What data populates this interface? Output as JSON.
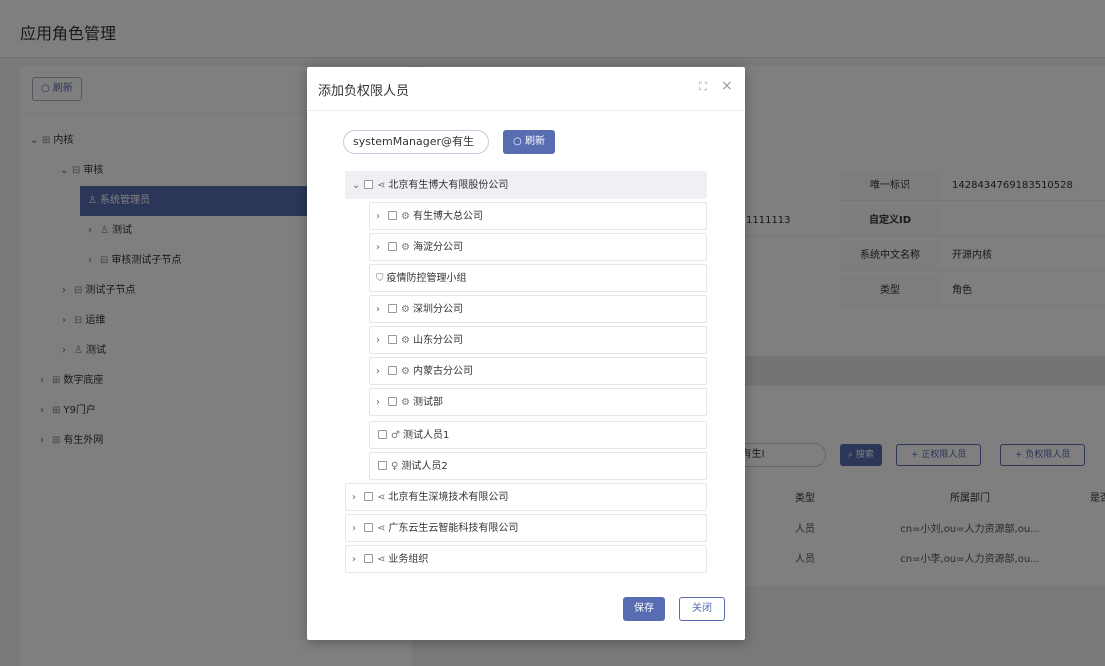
{
  "page": {
    "title": "应用角色管理"
  },
  "left": {
    "refresh_label": "刷新",
    "tree": [
      {
        "label": "内核",
        "icon": "grid-icon",
        "arrow": "v"
      },
      {
        "label": "审核",
        "icon": "folder-icon",
        "arrow": "v"
      },
      {
        "label": "系统管理员",
        "icon": "role-icon",
        "arrow": ""
      },
      {
        "label": "测试",
        "icon": "role-icon",
        "arrow": ">"
      },
      {
        "label": "审核测试子节点",
        "icon": "folder-icon",
        "arrow": ">"
      },
      {
        "label": "测试子节点",
        "icon": "folder-icon",
        "arrow": ">"
      },
      {
        "label": "运维",
        "icon": "folder-icon",
        "arrow": ">"
      },
      {
        "label": "测试",
        "icon": "role-icon",
        "arrow": ">"
      },
      {
        "label": "数字底座",
        "icon": "grid-icon",
        "arrow": ">"
      },
      {
        "label": "Y9门户",
        "icon": "grid-icon",
        "arrow": ">"
      },
      {
        "label": "有生外网",
        "icon": "grid-icon",
        "arrow": ">"
      }
    ]
  },
  "info": {
    "id_label": "唯一标识",
    "id_value": "1428434769183510528",
    "partial_left": "1111113",
    "custom_id_label": "自定义ID",
    "custom_id_value": "",
    "cn_name_label": "系统中文名称",
    "cn_name_value": "开源内核",
    "type_label": "类型",
    "type_value": "角色"
  },
  "grid": {
    "search_value": "ger@有生Ⅰ",
    "search_btn": "搜索",
    "add_positive": "+ 正权限人员",
    "add_negative": "+ 负权限人员",
    "headers": [
      "类型",
      "所属部门",
      "是否"
    ],
    "rows": [
      {
        "type": "人员",
        "dept": "cn=小刘,ou=人力资源部,ou..."
      },
      {
        "type": "人员",
        "dept": "cn=小李,ou=人力资源部,ou..."
      }
    ]
  },
  "modal": {
    "title": "添加负权限人员",
    "search_value": "systemManager@有生",
    "refresh_label": "刷新",
    "save_label": "保存",
    "close_label": "关闭",
    "tree": [
      {
        "label": "北京有生博大有限股份公司",
        "icon": "org-icon",
        "arrow": "v",
        "checkbox": true
      },
      {
        "label": "有生博大总公司",
        "icon": "dept-icon",
        "arrow": ">",
        "checkbox": true
      },
      {
        "label": "海淀分公司",
        "icon": "dept-icon",
        "arrow": ">",
        "checkbox": true
      },
      {
        "label": "疫情防控管理小组",
        "icon": "shield-icon",
        "arrow": "",
        "checkbox": false
      },
      {
        "label": "深圳分公司",
        "icon": "dept-icon",
        "arrow": ">",
        "checkbox": true
      },
      {
        "label": "山东分公司",
        "icon": "dept-icon",
        "arrow": ">",
        "checkbox": true
      },
      {
        "label": "内蒙古分公司",
        "icon": "dept-icon",
        "arrow": ">",
        "checkbox": true
      },
      {
        "label": "测试部",
        "icon": "dept-icon",
        "arrow": ">",
        "checkbox": true
      },
      {
        "label": "测试人员1",
        "icon": "male-icon",
        "arrow": "",
        "checkbox": true
      },
      {
        "label": "测试人员2",
        "icon": "female-icon",
        "arrow": "",
        "checkbox": true
      },
      {
        "label": "北京有生深境技术有限公司",
        "icon": "org-icon",
        "arrow": ">",
        "checkbox": true
      },
      {
        "label": "广东云生云智能科技有限公司",
        "icon": "org-icon",
        "arrow": ">",
        "checkbox": true
      },
      {
        "label": "业务组织",
        "icon": "org-icon",
        "arrow": ">",
        "checkbox": true
      }
    ]
  }
}
